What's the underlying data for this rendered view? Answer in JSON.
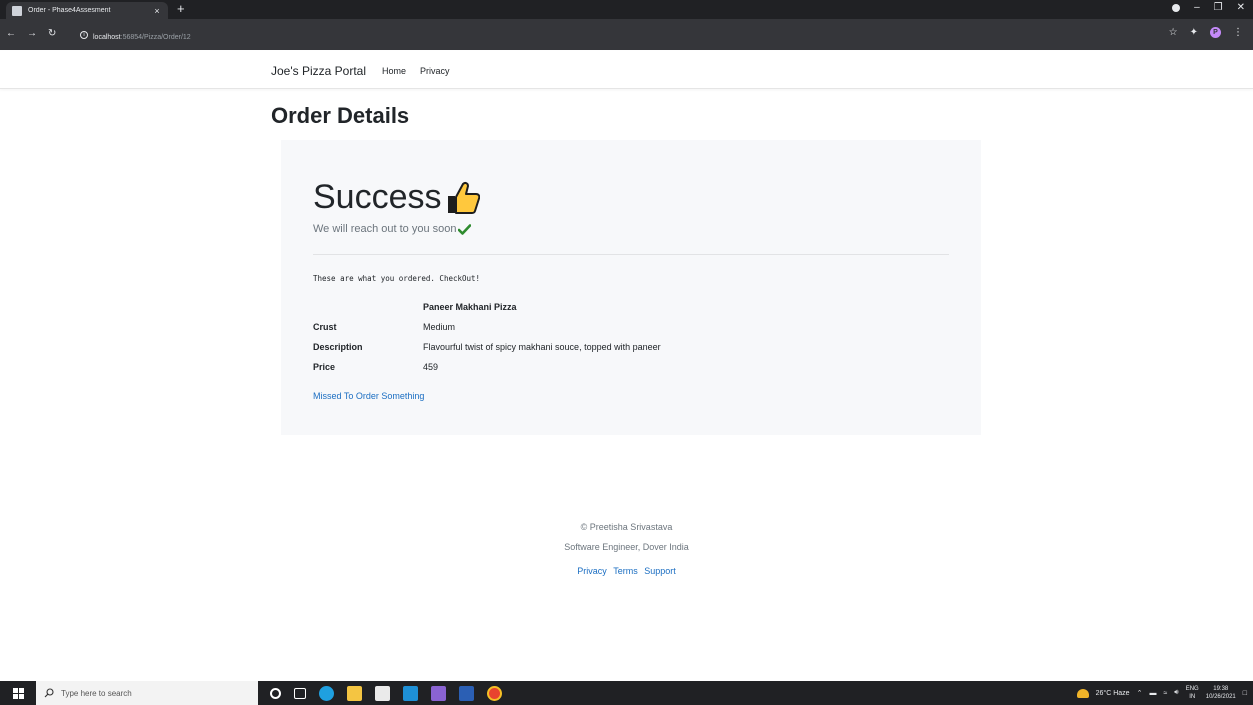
{
  "browser": {
    "tab_title": "Order - Phase4Assesment",
    "tab_close": "×",
    "new_tab": "+",
    "url_host": "localhost",
    "url_rest": ":56854/Pizza/Order/12",
    "profile_initial": "P"
  },
  "site": {
    "brand": "Joe's Pizza Portal",
    "nav": [
      "Home",
      "Privacy"
    ]
  },
  "main": {
    "heading": "Order Details",
    "success": "Success",
    "reach": "We will reach out to you soon",
    "ordered": "These are what you ordered. CheckOut!",
    "item_name": "Paneer Makhani Pizza",
    "details": [
      {
        "label": "Crust",
        "value": "Medium"
      },
      {
        "label": "Description",
        "value": "Flavourful twist of spicy makhani souce, topped with paneer"
      },
      {
        "label": "Price",
        "value": "459"
      }
    ],
    "missed_link": "Missed To Order Something"
  },
  "footer": {
    "copy": "© Preetisha Srivastava",
    "role": "Software Engineer, Dover India",
    "links": [
      "Privacy",
      "Terms",
      "Support"
    ]
  },
  "taskbar": {
    "search_placeholder": "Type here to search",
    "weather": "26°C Haze",
    "lang_top": "ENG",
    "lang_bottom": "IN",
    "time": "19:38",
    "date": "10/26/2021"
  },
  "colors": {
    "link": "#1b6ec2",
    "jumbotron_bg": "#f7f8fa"
  }
}
